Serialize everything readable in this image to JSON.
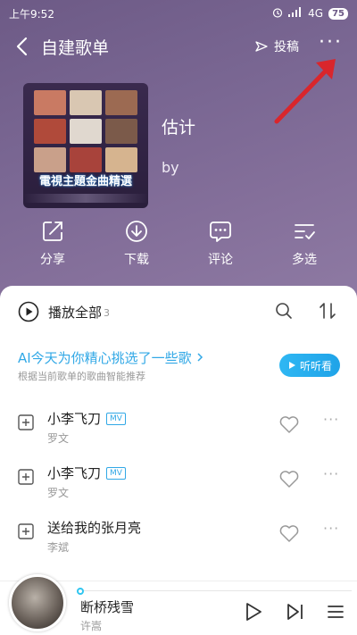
{
  "status_bar": {
    "time": "上午9:52",
    "network": "4G",
    "battery": "75"
  },
  "nav": {
    "title": "自建歌单",
    "contribute_label": "投稿",
    "more_glyph": "···"
  },
  "playlist": {
    "cover_text": "電視主題金曲精選",
    "name": "估计",
    "by": "by"
  },
  "actions": [
    {
      "label": "分享",
      "icon": "share-icon"
    },
    {
      "label": "下载",
      "icon": "download-icon"
    },
    {
      "label": "评论",
      "icon": "comment-icon"
    },
    {
      "label": "多选",
      "icon": "multiselect-icon"
    }
  ],
  "list_header": {
    "play_all_label": "播放全部",
    "count": "3"
  },
  "ai_banner": {
    "title": "AI今天为你精心挑选了一些歌",
    "subtitle": "根据当前歌单的歌曲智能推荐",
    "button_label": "听听看"
  },
  "songs": [
    {
      "title": "小李飞刀",
      "mv": "MV",
      "artist": "罗文"
    },
    {
      "title": "小李飞刀",
      "mv": "MV",
      "artist": "罗文"
    },
    {
      "title": "送给我的张月亮",
      "mv": "",
      "artist": "李斌"
    }
  ],
  "player": {
    "title": "断桥残雪",
    "artist": "许嵩"
  },
  "colors": {
    "accent": "#31a8e6",
    "hero_bg": "#7a6793",
    "arrow": "#d9262c"
  }
}
